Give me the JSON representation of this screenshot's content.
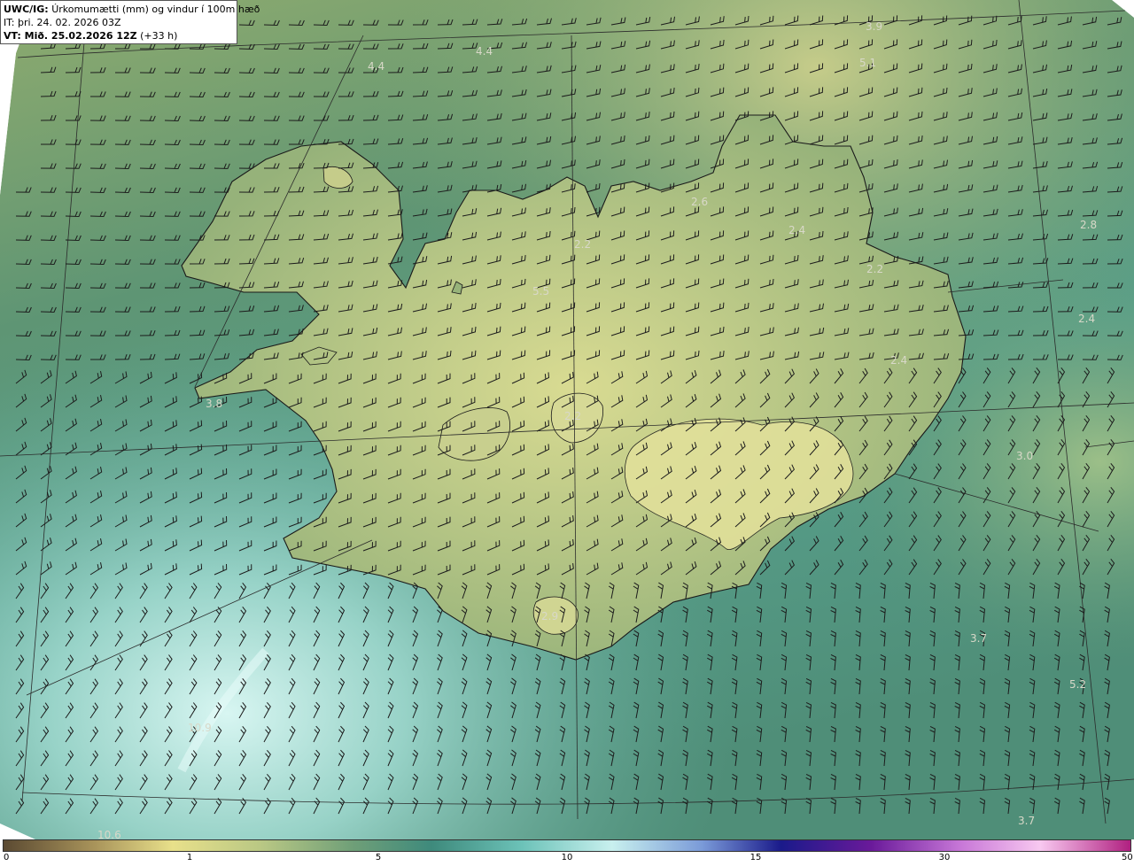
{
  "info": {
    "model": "UWC/IG:",
    "product": "Úrkomumætti (mm) og vindur í 100m hæð",
    "init": "IT: þri. 24. 02. 2026 03Z",
    "valid_bold": "VT: Mið. 25.02.2026 12Z",
    "valid_lead": "(+33 h)"
  },
  "map_values": [
    "3.9",
    "4.4",
    "4.4",
    "5.1",
    "2.6",
    "5.5",
    "2.2",
    "2.4",
    "2.2",
    "2.8",
    "2.4",
    "2.4",
    "3.8",
    "2.2",
    "3.0",
    "2.9",
    "3.7",
    "5.2",
    "10.9",
    "10.6",
    "3.7"
  ],
  "colorbar": {
    "ticks": [
      "0",
      "1",
      "5",
      "10",
      "15",
      "30",
      "50"
    ],
    "colors": [
      "#5b4a32",
      "#a8935a",
      "#e8e08a",
      "#b8c784",
      "#6f9f78",
      "#3e8a7c",
      "#6cc2b8",
      "#c8f0ee",
      "#7a9ad8",
      "#1a1a8a",
      "#6a1a9a",
      "#c878d8",
      "#f8c8f0",
      "#b02080"
    ]
  },
  "colors": {
    "land_base": "#b9c47d",
    "sea_base": "#4e8c6e",
    "south_sea": "#a8dcd0",
    "coast": "#1a1a1a"
  }
}
